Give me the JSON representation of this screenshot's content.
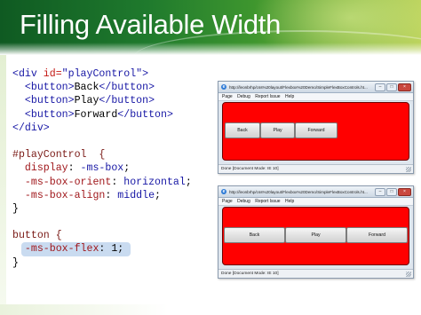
{
  "slide": {
    "title": "Filling Available Width"
  },
  "code": {
    "lines": [
      [
        {
          "t": "<div ",
          "c": "tag"
        },
        {
          "t": "id=",
          "c": "attr"
        },
        {
          "t": "\"playControl\"",
          "c": "str"
        },
        {
          "t": ">",
          "c": "tag"
        }
      ],
      [
        {
          "t": "  <button>",
          "c": "tag"
        },
        {
          "t": "Back",
          "c": "txt"
        },
        {
          "t": "</button>",
          "c": "tag"
        }
      ],
      [
        {
          "t": "  <button>",
          "c": "tag"
        },
        {
          "t": "Play",
          "c": "txt"
        },
        {
          "t": "</button>",
          "c": "tag"
        }
      ],
      [
        {
          "t": "  <button>",
          "c": "tag"
        },
        {
          "t": "Forward",
          "c": "txt"
        },
        {
          "t": "</button>",
          "c": "tag"
        }
      ],
      [
        {
          "t": "</div>",
          "c": "tag"
        }
      ],
      [
        {
          "t": "",
          "c": "txt"
        }
      ],
      [
        {
          "t": "#playControl  {",
          "c": "sel"
        }
      ],
      [
        {
          "t": "  display",
          "c": "prop"
        },
        {
          "t": ": ",
          "c": "txt"
        },
        {
          "t": "-ms-box",
          "c": "val"
        },
        {
          "t": ";",
          "c": "txt"
        }
      ],
      [
        {
          "t": "  -ms-box-orient",
          "c": "prop"
        },
        {
          "t": ": ",
          "c": "txt"
        },
        {
          "t": "horizontal",
          "c": "val"
        },
        {
          "t": ";",
          "c": "txt"
        }
      ],
      [
        {
          "t": "  -ms-box-align",
          "c": "prop"
        },
        {
          "t": ": ",
          "c": "txt"
        },
        {
          "t": "middle",
          "c": "val"
        },
        {
          "t": ";",
          "c": "txt"
        }
      ],
      [
        {
          "t": "}",
          "c": "txt"
        }
      ],
      [
        {
          "t": "",
          "c": "txt"
        }
      ],
      [
        {
          "t": "button {",
          "c": "sel"
        }
      ],
      [
        {
          "t": "  ",
          "c": "txt"
        },
        {
          "t": "-ms-box-flex",
          "c": "prop",
          "hl": true
        },
        {
          "t": ": 1;",
          "c": "txt",
          "hl": true
        }
      ],
      [
        {
          "t": "}",
          "c": "txt"
        }
      ]
    ]
  },
  "browser1": {
    "url": "http://leonbrhp/css%20layout/Flexbox%20Demo/SimpleFlexBoxControls.ht...",
    "menu": [
      "Page",
      "Debug",
      "Report Issue",
      "Help"
    ],
    "buttons": [
      "Back",
      "Play",
      "Forward"
    ],
    "status": "Done [Document Mode: IE 10]"
  },
  "browser2": {
    "url": "http://leonbrhp/css%20layout/Flexbox%20Demo/SimpleFlexBoxControls.ht...",
    "menu": [
      "Page",
      "Debug",
      "Report Issue",
      "Help"
    ],
    "buttons": [
      "Back",
      "Play",
      "Forward"
    ],
    "status": "Done [Document Mode: IE 10]"
  },
  "colors": {
    "client_background": "#ff0000",
    "header_green": "#1f7a2d",
    "code_highlight": "#c9dbf0"
  }
}
